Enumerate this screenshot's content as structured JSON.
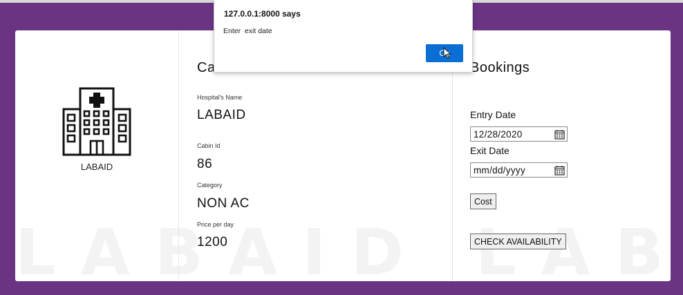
{
  "hospital": {
    "logo_icon": "hospital-building-icon",
    "name_caption": "LABAID"
  },
  "details": {
    "title": "Ca",
    "hospital_name_label": "Hospital's Name",
    "hospital_name_value": "LABAID",
    "cabin_id_label": "Cabin Id",
    "cabin_id_value": "86",
    "category_label": "Category",
    "category_value": "NON AC",
    "price_label": "Price per day",
    "price_value": "1200"
  },
  "bookings": {
    "title": "Bookings",
    "entry_label": "Entry Date",
    "entry_value": "12/28/2020",
    "exit_label": "Exit Date",
    "exit_placeholder": "mm/dd/yyyy",
    "cost_button": "Cost",
    "availability_button": "CHECK AVAILABILITY"
  },
  "dialog": {
    "origin": "127.0.0.1:8000 says",
    "message": "Enter  exit date",
    "ok_label": "Ok"
  },
  "colors": {
    "page_background": "#6b3483",
    "dialog_button": "#0a6fd4"
  }
}
